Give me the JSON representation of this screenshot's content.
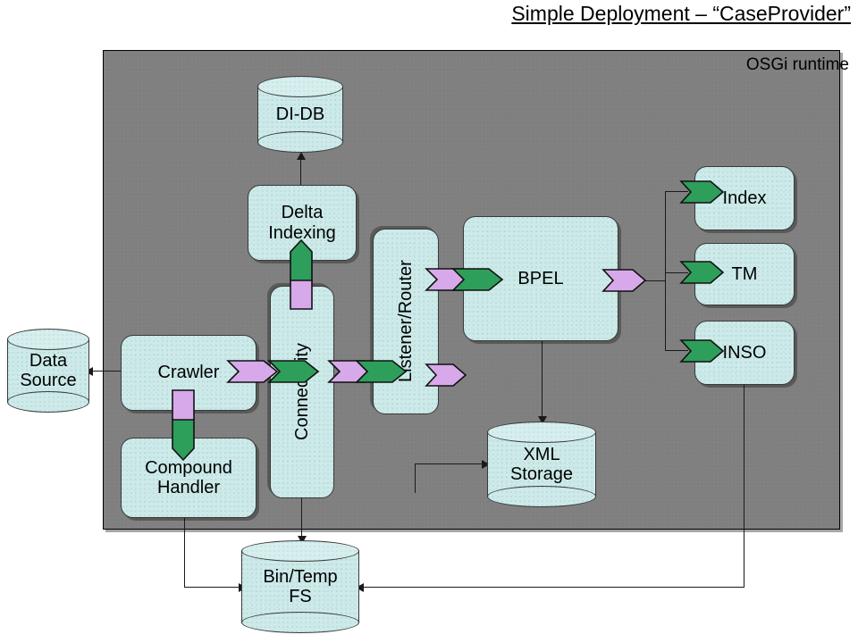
{
  "title": "Simple Deployment – “CaseProvider”",
  "container": {
    "label": "OSGi runtime"
  },
  "colors": {
    "box_fill": "#cdeae9",
    "container_fill": "#808080",
    "provided_interface": "#d7a9ea",
    "required_interface": "#2e9e5b",
    "line": "#1a1a1a",
    "page_background": "#ffffff"
  },
  "components": {
    "data_source": "Data\nSource",
    "data_source_line1": "Data",
    "data_source_line2": "Source",
    "crawler": "Crawler",
    "compound_handler_line1": "Compound",
    "compound_handler_line2": "Handler",
    "connectivity": "Connectivity",
    "delta_indexing_line1": "Delta",
    "delta_indexing_line2": "Indexing",
    "di_db": "DI-DB",
    "listener_router": "Listener/Router",
    "bpel": "BPEL",
    "xml_storage_line1": "XML",
    "xml_storage_line2": "Storage",
    "bin_temp_fs_line1": "Bin/Temp",
    "bin_temp_fs_line2": "FS",
    "index": "Index",
    "tm": "TM",
    "inso": "INSO"
  },
  "connections": [
    {
      "from": "Crawler",
      "to": "Data Source",
      "style": "arrow"
    },
    {
      "from": "Crawler",
      "to": "Connectivity",
      "style": "interface"
    },
    {
      "from": "Crawler",
      "to": "Compound Handler",
      "style": "interface"
    },
    {
      "from": "Connectivity",
      "to": "Delta Indexing",
      "style": "interface"
    },
    {
      "from": "Delta Indexing",
      "to": "DI-DB",
      "style": "arrow"
    },
    {
      "from": "Connectivity",
      "to": "Listener/Router",
      "style": "interface"
    },
    {
      "from": "Listener/Router",
      "to": "BPEL",
      "style": "interface"
    },
    {
      "from": "BPEL",
      "to": "Index",
      "style": "interface"
    },
    {
      "from": "BPEL",
      "to": "TM",
      "style": "interface"
    },
    {
      "from": "BPEL",
      "to": "INSO",
      "style": "interface"
    },
    {
      "from": "BPEL",
      "to": "XML Storage",
      "style": "arrow"
    },
    {
      "from": "Connectivity",
      "to": "XML Storage",
      "style": "arrow"
    },
    {
      "from": "Connectivity",
      "to": "Bin/Temp FS",
      "style": "arrow"
    },
    {
      "from": "Compound Handler",
      "to": "Bin/Temp FS",
      "style": "arrow"
    },
    {
      "from": "INSO",
      "to": "Bin/Temp FS",
      "style": "arrow"
    }
  ]
}
